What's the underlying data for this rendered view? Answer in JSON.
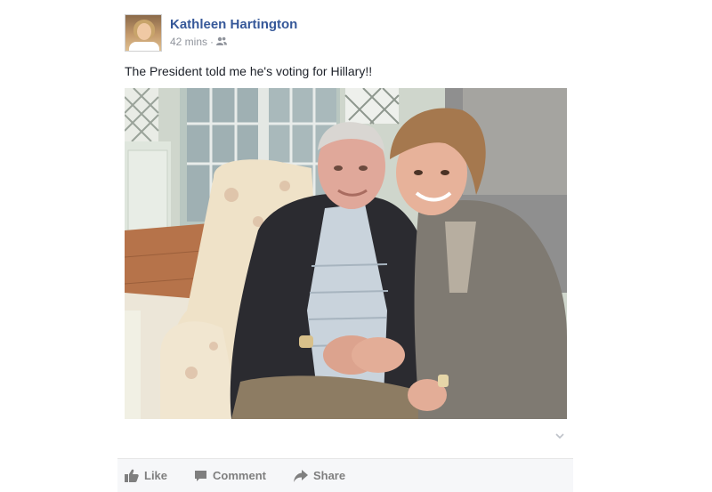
{
  "post": {
    "author": "Kathleen Hartington",
    "time": "42 mins",
    "separator": "·",
    "audience_icon": "friends-icon",
    "status_text": "The President told me he's voting for Hillary!!"
  },
  "actions": {
    "like_label": "Like",
    "comment_label": "Comment",
    "share_label": "Share"
  },
  "colors": {
    "name": "#365899",
    "meta": "#90949c",
    "action": "#7f7f7f",
    "action_bar_bg": "#f6f7f9"
  }
}
